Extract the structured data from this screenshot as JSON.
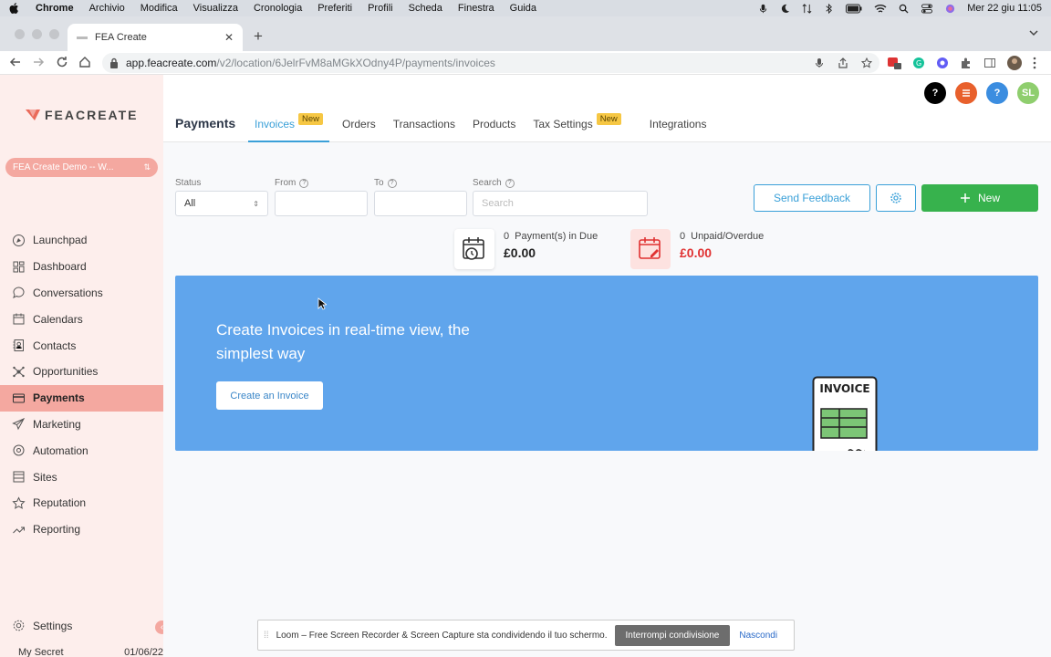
{
  "mac_menu": {
    "items": [
      "Chrome",
      "Archivio",
      "Modifica",
      "Visualizza",
      "Cronologia",
      "Preferiti",
      "Profili",
      "Scheda",
      "Finestra",
      "Guida"
    ],
    "datetime": "Mer 22 giu  11:05"
  },
  "browser": {
    "tab_title": "FEA Create",
    "url_host": "app.feacreate.com",
    "url_path": "/v2/location/6JelrFvM8aMGkXOdny4P/payments/invoices"
  },
  "sidebar": {
    "logo_text": "FEACREATE",
    "location_label": "FEA Create Demo -- W...",
    "items": [
      {
        "label": "Launchpad",
        "icon": "launchpad-icon"
      },
      {
        "label": "Dashboard",
        "icon": "dashboard-icon"
      },
      {
        "label": "Conversations",
        "icon": "chat-icon"
      },
      {
        "label": "Calendars",
        "icon": "calendar-icon"
      },
      {
        "label": "Contacts",
        "icon": "contacts-icon"
      },
      {
        "label": "Opportunities",
        "icon": "opportunities-icon"
      },
      {
        "label": "Payments",
        "icon": "payments-icon"
      },
      {
        "label": "Marketing",
        "icon": "send-icon"
      },
      {
        "label": "Automation",
        "icon": "automation-icon"
      },
      {
        "label": "Sites",
        "icon": "sites-icon"
      },
      {
        "label": "Reputation",
        "icon": "star-icon"
      },
      {
        "label": "Reporting",
        "icon": "trend-icon"
      }
    ],
    "settings_label": "Settings",
    "peek_text": "My Secret Sister",
    "peek_date": "01/06/22"
  },
  "header": {
    "page_title": "Payments",
    "tabs": [
      {
        "label": "Invoices",
        "badge": "New"
      },
      {
        "label": "Orders",
        "badge": ""
      },
      {
        "label": "Transactions",
        "badge": ""
      },
      {
        "label": "Products",
        "badge": ""
      },
      {
        "label": "Tax Settings",
        "badge": "New"
      },
      {
        "label": "Integrations",
        "badge": ""
      }
    ],
    "avatar_initials": "SL",
    "help_glyph": "?"
  },
  "filters": {
    "status_label": "Status",
    "status_value": "All",
    "from_label": "From",
    "to_label": "To",
    "search_label": "Search",
    "search_placeholder": "Search"
  },
  "actions": {
    "feedback_label": "Send Feedback",
    "new_label": "New"
  },
  "stats": {
    "due_count": "0",
    "due_label": "Payment(s) in Due",
    "due_amount": "£0.00",
    "overdue_count": "0",
    "overdue_label": "Unpaid/Overdue",
    "overdue_amount": "£0.00"
  },
  "banner": {
    "title": "Create Invoices in real-time view, the simplest way",
    "button_label": "Create an Invoice",
    "illustration_text": "INVOICE"
  },
  "loom": {
    "message": "Loom – Free Screen Recorder & Screen Capture sta condividendo il tuo schermo.",
    "stop_label": "Interrompi condivisione",
    "hide_label": "Nascondi"
  },
  "colors": {
    "accent_blue": "#3aa0d8",
    "green": "#37b24d",
    "sidebar_bg": "#fdeeec",
    "sidebar_active": "#f4a8a0",
    "banner_bg": "#60a5ec",
    "overdue_red": "#e03131"
  }
}
